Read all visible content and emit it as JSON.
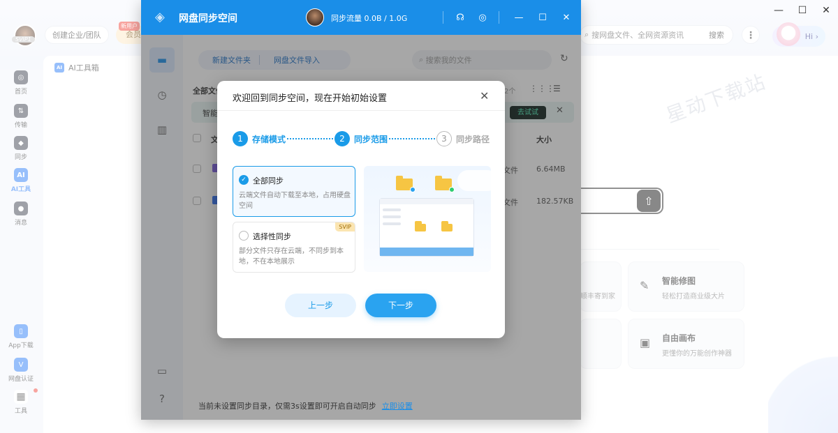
{
  "main_app": {
    "user": {
      "svip_tag": "SVIP1"
    },
    "org_button": "创建企业/团队",
    "member_button": "会员",
    "new_user_tag": "新用户",
    "search": {
      "placeholder": "搜网盘文件、全网资源资讯",
      "button": "搜索"
    },
    "more_label": "⋮",
    "hi_label": "Hi ›",
    "window_controls": [
      "—",
      "☐",
      "✕"
    ],
    "sidebar": [
      {
        "label": "首页",
        "icon": "home-icon",
        "glyph": "◎"
      },
      {
        "label": "传输",
        "icon": "transfer-icon",
        "glyph": "⇅"
      },
      {
        "label": "同步",
        "icon": "sync-icon",
        "glyph": "◆"
      },
      {
        "label": "AI工具",
        "icon": "ai-icon",
        "glyph": "AI",
        "active": true
      },
      {
        "label": "消息",
        "icon": "message-icon",
        "glyph": "●"
      },
      {
        "label": "App下载",
        "icon": "app-download-icon",
        "glyph": "▯"
      },
      {
        "label": "网盘认证",
        "icon": "verify-icon",
        "glyph": "V"
      },
      {
        "label": "工具",
        "icon": "tools-icon",
        "glyph": "▦"
      }
    ],
    "tab": {
      "label": "AI工具箱",
      "icon_text": "AI"
    },
    "watermark": "星动下载站",
    "tools": [
      {
        "title": "智能修图",
        "desc": "轻松打造商业级大片",
        "icon": "portrait-icon",
        "glyph": "✎"
      },
      {
        "title": "自由画布",
        "desc": "更懂你的万能创作神器",
        "icon": "canvas-icon",
        "glyph": "▣"
      }
    ],
    "partial_text": "顺丰寄到家"
  },
  "sync_app": {
    "title": "网盘同步空间",
    "traffic": "同步流量 0.0B / 1.0G",
    "header_icons": [
      "headset-icon",
      "settings-icon"
    ],
    "header_glyphs": [
      "☊",
      "◎"
    ],
    "window_controls": [
      "—",
      "☐",
      "✕"
    ],
    "toolbar": {
      "new_folder": "新建文件夹",
      "import": "网盘文件导入"
    },
    "search_placeholder": "搜索我的文件",
    "all_files": "全部文件",
    "count": "2个",
    "banner": {
      "text": "智能",
      "try": "去试试"
    },
    "header": {
      "name": "文",
      "size": "大小"
    },
    "rows": [
      {
        "type": "文件",
        "size": "6.64MB"
      },
      {
        "type": "文件",
        "size": "182.57KB"
      }
    ],
    "footer": {
      "text": "当前未设置同步目录，仅需3s设置即可开启自动同步",
      "link": "立即设置"
    }
  },
  "dialog": {
    "title": "欢迎回到同步空间，现在开始初始设置",
    "steps": [
      {
        "num": "1",
        "label": "存储模式",
        "state": "done"
      },
      {
        "num": "2",
        "label": "同步范围",
        "state": "active"
      },
      {
        "num": "3",
        "label": "同步路径",
        "state": "pending"
      }
    ],
    "options": [
      {
        "title": "全部同步",
        "desc": "云端文件自动下载至本地，占用硬盘空间",
        "selected": true
      },
      {
        "title": "选择性同步",
        "desc": "部分文件只存在云端，不同步到本地，不在本地展示",
        "selected": false,
        "badge": "SVIP"
      }
    ],
    "prev_button": "上一步",
    "next_button": "下一步"
  }
}
